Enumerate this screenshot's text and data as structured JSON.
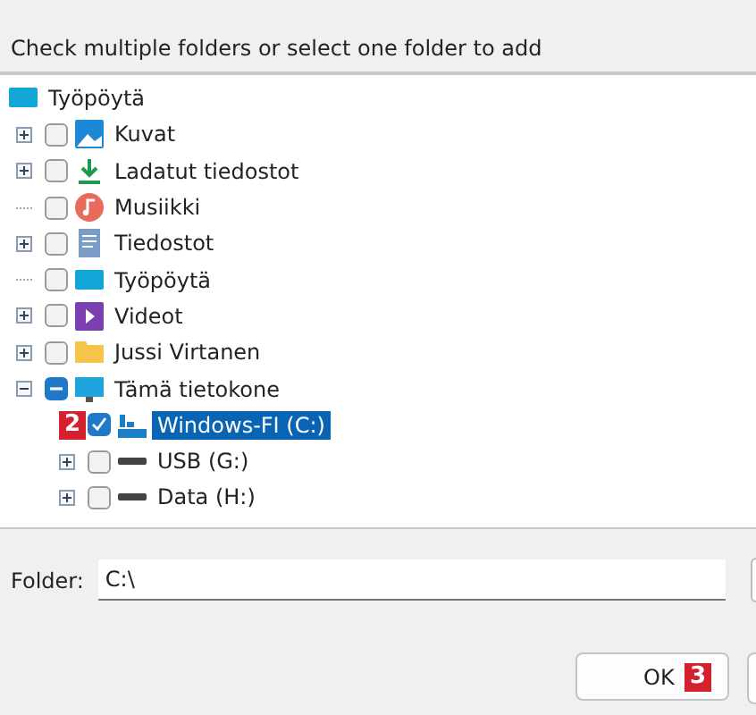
{
  "instruction": "Check multiple folders or select one folder to add",
  "tree": {
    "label": "Työpöytä",
    "kind": "desktop",
    "children": [
      {
        "label": "Kuvat",
        "kind": "pictures",
        "expanded": false,
        "checked": false,
        "partial": false,
        "selected": false
      },
      {
        "label": "Ladatut tiedostot",
        "kind": "download",
        "expanded": false,
        "checked": false,
        "partial": false,
        "selected": false
      },
      {
        "label": "Musiikki",
        "kind": "music",
        "checked": false,
        "partial": false,
        "selected": false
      },
      {
        "label": "Tiedostot",
        "kind": "documents",
        "expanded": false,
        "checked": false,
        "partial": false,
        "selected": false
      },
      {
        "label": "Työpöytä",
        "kind": "desktop",
        "checked": false,
        "partial": false,
        "selected": false
      },
      {
        "label": "Videot",
        "kind": "videos",
        "expanded": false,
        "checked": false,
        "partial": false,
        "selected": false
      },
      {
        "label": "Jussi Virtanen",
        "kind": "folder",
        "expanded": false,
        "checked": false,
        "partial": false,
        "selected": false
      },
      {
        "label": "Tämä tietokone",
        "kind": "computer",
        "expanded": true,
        "checked": false,
        "partial": true,
        "selected": false,
        "children": [
          {
            "label": "Windows-FI (C:)",
            "kind": "system-drive",
            "checked": true,
            "partial": false,
            "selected": true,
            "badge": "2"
          },
          {
            "label": "USB (G:)",
            "kind": "drive",
            "expanded": false,
            "checked": false,
            "partial": false,
            "selected": false
          },
          {
            "label": "Data (H:)",
            "kind": "drive",
            "expanded": false,
            "checked": false,
            "partial": false,
            "selected": false
          }
        ]
      }
    ]
  },
  "folder": {
    "label": "Folder:",
    "value": "C:\\"
  },
  "ok_button": {
    "label": "OK",
    "badge": "3"
  }
}
